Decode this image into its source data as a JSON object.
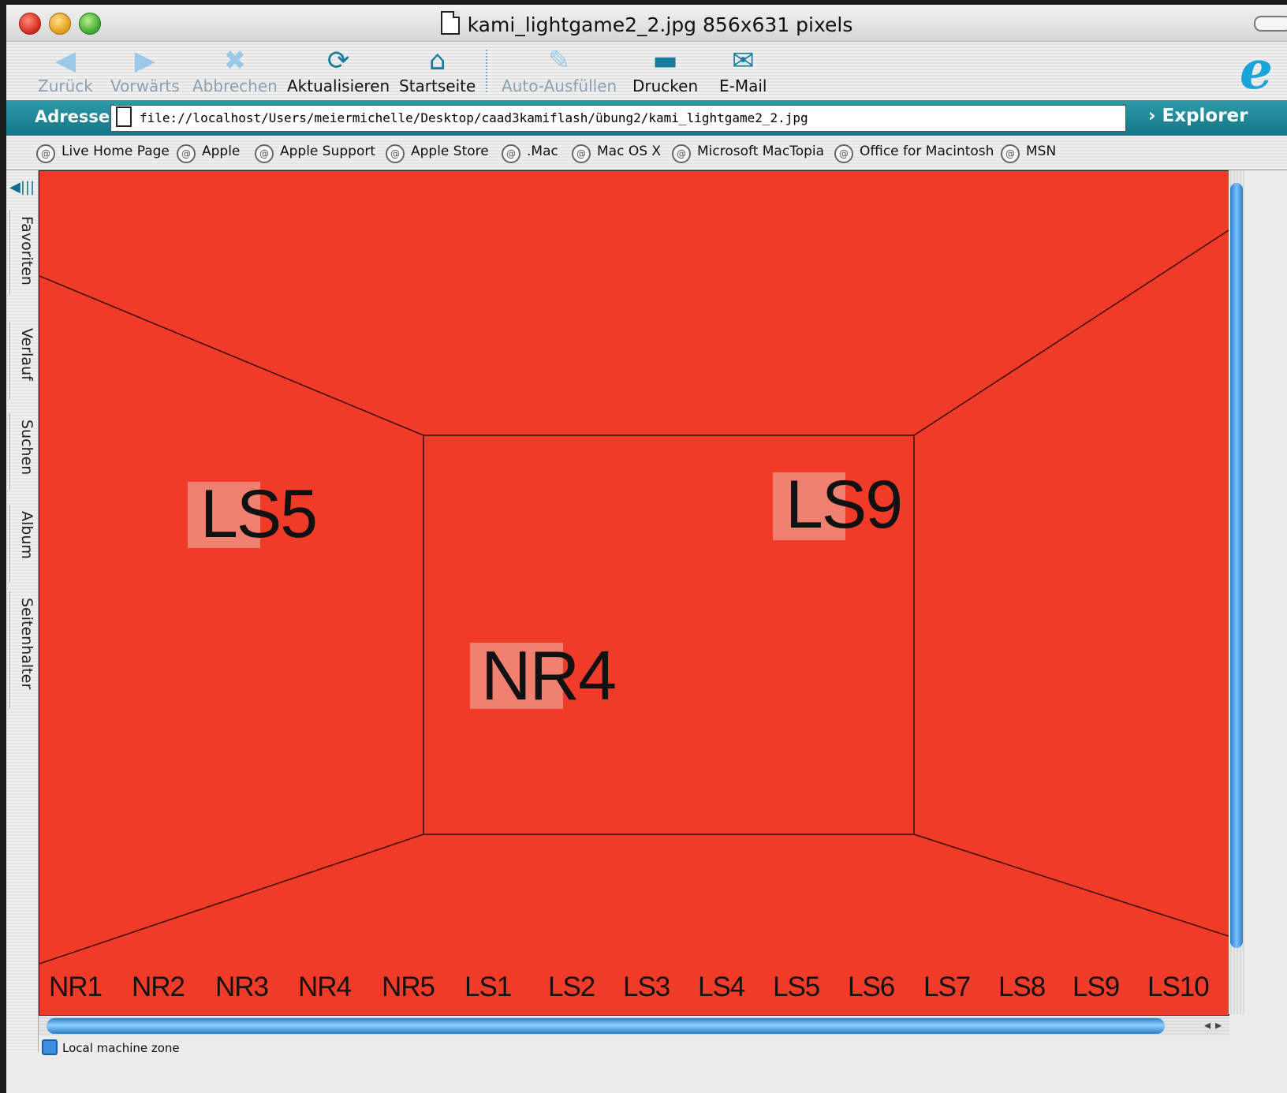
{
  "window": {
    "title": "kami_lightgame2_2.jpg 856x631 pixels"
  },
  "toolbar": {
    "back": {
      "label": "Zurück",
      "icon": "arrow-left-icon"
    },
    "forward": {
      "label": "Vorwärts",
      "icon": "arrow-right-icon"
    },
    "stop": {
      "label": "Abbrechen",
      "icon": "x-icon"
    },
    "refresh": {
      "label": "Aktualisieren",
      "icon": "refresh-icon"
    },
    "home": {
      "label": "Startseite",
      "icon": "home-icon"
    },
    "autofill": {
      "label": "Auto-Ausfüllen",
      "icon": "autofill-icon"
    },
    "print": {
      "label": "Drucken",
      "icon": "printer-icon"
    },
    "mail": {
      "label": "E-Mail",
      "icon": "envelope-icon"
    }
  },
  "address": {
    "label": "Adresse:",
    "url": "file://localhost/Users/meiermichelle/Desktop/caad3kamiflash/übung2/kami_lightgame2_2.jpg",
    "explorer": "Explorer"
  },
  "favorites": [
    "Live Home Page",
    "Apple",
    "Apple Support",
    "Apple Store",
    ".Mac",
    "Mac OS X",
    "Microsoft MacTopia",
    "Office for Macintosh",
    "MSN"
  ],
  "sidebar": {
    "tabs": [
      "Favoriten",
      "Verlauf",
      "Suchen",
      "Album",
      "Seitenhalter"
    ]
  },
  "image": {
    "labels": {
      "left_wall": "LS5",
      "right_wall": "LS9",
      "back_wall": "NR4"
    },
    "bottom_row": [
      "NR1",
      "NR2",
      "NR3",
      "NR4",
      "NR5",
      "LS1",
      "LS2",
      "LS3",
      "LS4",
      "LS5",
      "LS6",
      "LS7",
      "LS8",
      "LS9",
      "LS10"
    ],
    "background_color": "#ef3b28",
    "highlight_color": "#f08070"
  },
  "status": {
    "zone": "Local machine zone"
  }
}
